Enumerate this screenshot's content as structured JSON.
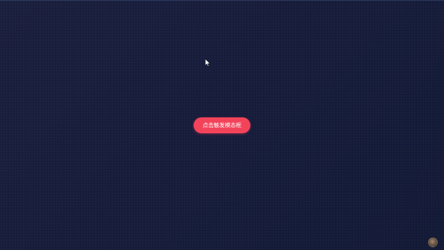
{
  "page": {
    "background_color": "#171c39",
    "accent_color": "#f2435a"
  },
  "button": {
    "label": "点击触发模态框"
  },
  "cursor": {
    "icon": "pointer-cursor-icon"
  },
  "avatar": {
    "icon": "user-avatar-icon"
  }
}
